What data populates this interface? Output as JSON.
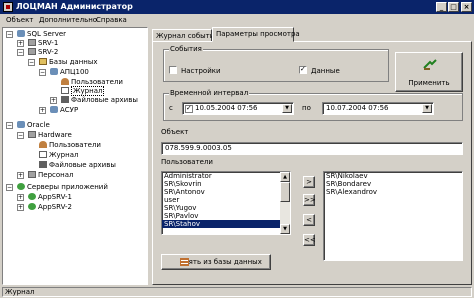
{
  "window": {
    "title": "ЛОЦМАН Администратор",
    "minimize": "_",
    "maximize": "□",
    "close": "×"
  },
  "menu": [
    "Объект",
    "Дополнительно",
    "Справка"
  ],
  "tree": {
    "nodes": [
      {
        "label": "SQL Server",
        "icon": "database-icon",
        "expander": "−"
      },
      {
        "label": "SRV-1",
        "icon": "server-icon",
        "expander": "+"
      },
      {
        "label": "SRV-2",
        "icon": "server-icon",
        "expander": "−"
      },
      {
        "label": "Базы данных",
        "icon": "folder-icon",
        "expander": "−"
      },
      {
        "label": "АПЦ100",
        "icon": "database-icon",
        "expander": "−"
      },
      {
        "label": "Пользователи",
        "icon": "users-icon"
      },
      {
        "label": "Журнал",
        "icon": "journal-icon"
      },
      {
        "label": "Файловые архивы",
        "icon": "archive-icon",
        "expander": "+"
      },
      {
        "label": "АСУР",
        "icon": "database-icon",
        "expander": "+"
      },
      {
        "label": "Oracle",
        "icon": "database-icon",
        "expander": "−"
      },
      {
        "label": "Hardware",
        "icon": "server-icon",
        "expander": "−"
      },
      {
        "label": "Пользователи",
        "icon": "users-icon"
      },
      {
        "label": "Журнал",
        "icon": "journal-icon"
      },
      {
        "label": "Файловые архивы",
        "icon": "archive-icon"
      },
      {
        "label": "Персонал",
        "icon": "server-icon",
        "expander": "+"
      },
      {
        "label": "Серверы приложений",
        "icon": "app-server-icon",
        "expander": "−"
      },
      {
        "label": "AppSRV-1",
        "icon": "app-server-icon",
        "expander": "+"
      },
      {
        "label": "AppSRV-2",
        "icon": "app-server-icon",
        "expander": "+"
      }
    ]
  },
  "tabs": [
    "Журнал событий",
    "Параметры просмотра"
  ],
  "events_group": {
    "title": "События",
    "settings_label": "Настройки",
    "settings_checked": false,
    "data_label": "Данные",
    "data_checked": true
  },
  "apply_button": {
    "label": "Применить"
  },
  "time_interval": {
    "title": "Временной интервал",
    "from_label": "с",
    "from_value": "10.05.2004  07:56",
    "from_checked": true,
    "to_label": "по",
    "to_value": "10.07.2004 07:56",
    "dropdown_glyph": "▼"
  },
  "object": {
    "label": "Объект",
    "value": "078.599.9.0003.05"
  },
  "users": {
    "label": "Пользователи",
    "available": [
      "Administrator",
      "SR\\Skovrin",
      "SR\\Antonov",
      "user",
      "SR\\Yugov",
      "SR\\Pavlov",
      "SR\\Stahov"
    ],
    "selected_index": 6,
    "chosen": [
      "SR\\Nikolaev",
      "SR\\Bondarev",
      "SR\\Alexandrov"
    ],
    "move_buttons": [
      ">",
      ">>",
      "<",
      "<<"
    ],
    "load_button": "Взять из базы данных"
  },
  "statusbar": {
    "text": "Журнал"
  }
}
